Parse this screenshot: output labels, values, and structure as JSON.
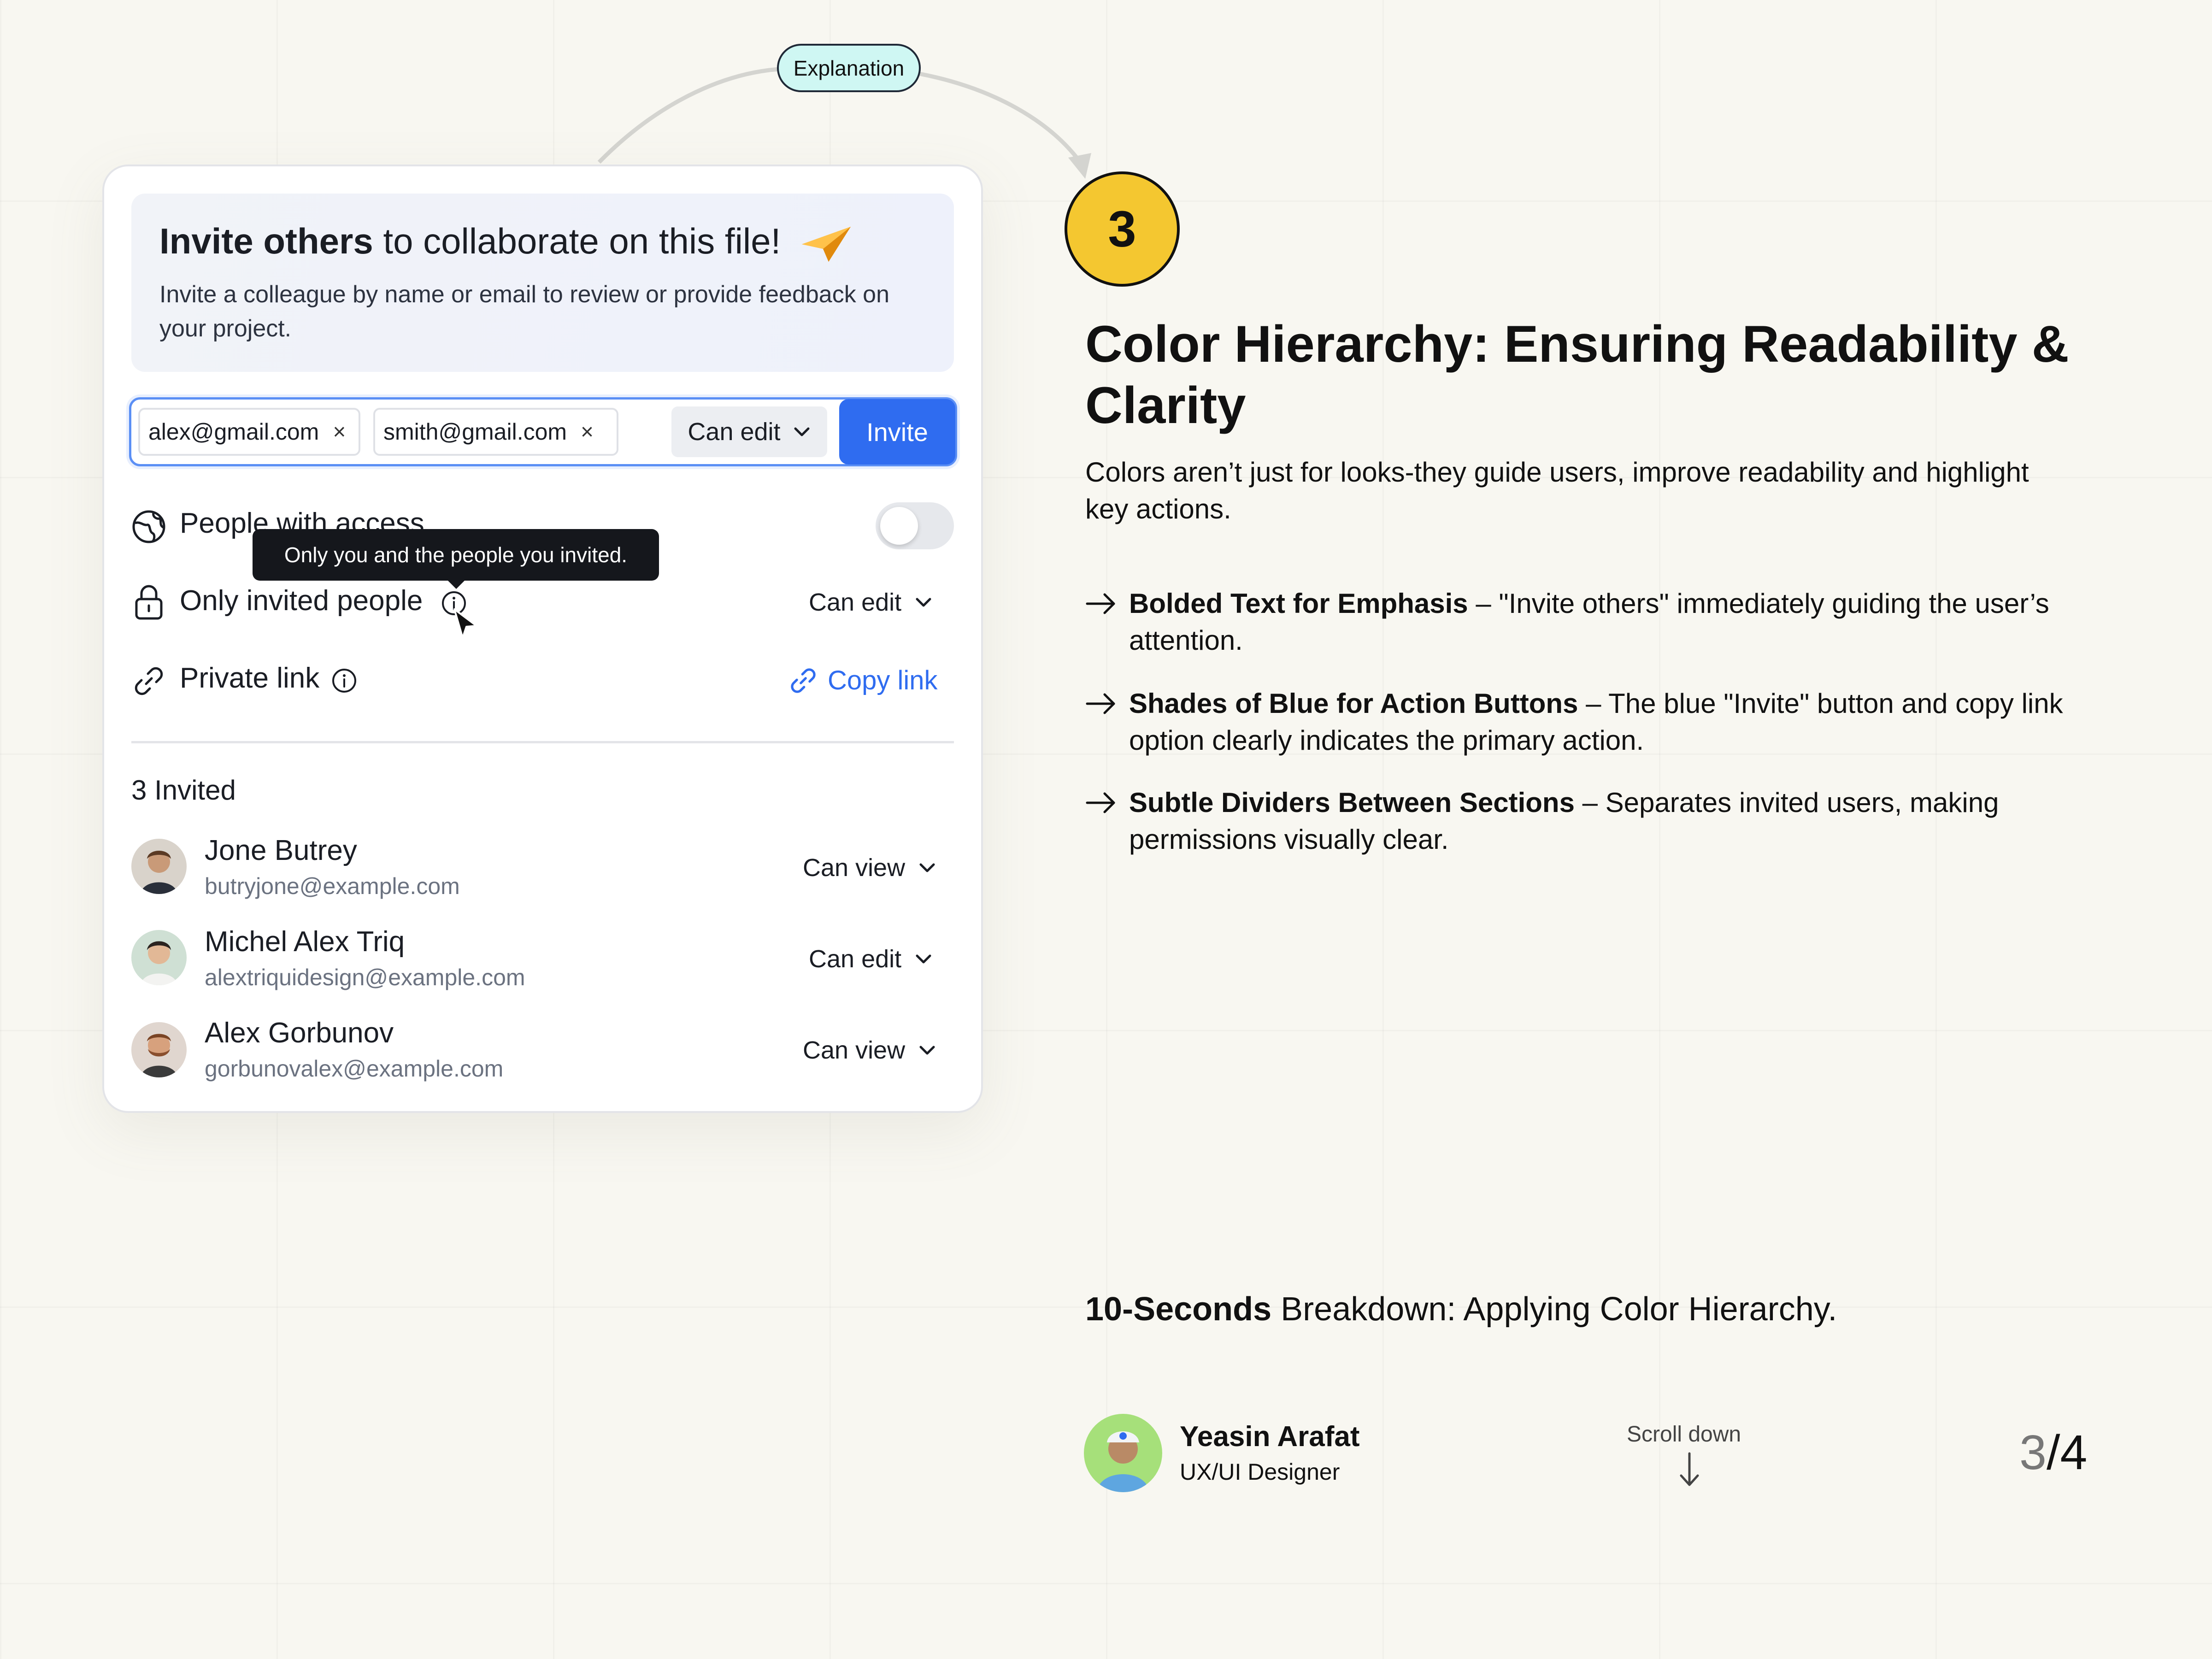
{
  "pill": {
    "label": "Explanation"
  },
  "card": {
    "title_bold": "Invite others",
    "title_rest": " to collaborate on this file!",
    "subtitle": "Invite a colleague by name or email to review or provide feedback on your project.",
    "chips": [
      "alex@gmail.com",
      "smith@gmail.com"
    ],
    "chip_remove": "×",
    "permission": "Can edit",
    "invite_button": "Invite",
    "people_with_access": "People with access",
    "tooltip": "Only you and the people you invited.",
    "only_invited": "Only invited people",
    "only_invited_perm": "Can edit",
    "private_link": "Private link",
    "copy_link": "Copy link",
    "invited_count": "3 Invited",
    "people": [
      {
        "name": "Jone Butrey",
        "email": "butryjone@example.com",
        "permission": "Can view"
      },
      {
        "name": "Michel Alex Triq",
        "email": "alextriquidesign@example.com",
        "permission": "Can edit"
      },
      {
        "name": "Alex Gorbunov",
        "email": "gorbunovalex@example.com",
        "permission": "Can view"
      }
    ]
  },
  "step": {
    "number": "3"
  },
  "heading": "Color Hierarchy: Ensuring Readability & Clarity",
  "lede": "Colors aren’t just for looks-they guide users, improve readability and highlight key actions.",
  "bullets": [
    {
      "bold": "Bolded Text for Emphasis",
      "rest": " – \"Invite others\" immediately guiding the user’s attention."
    },
    {
      "bold": "Shades of Blue for Action Buttons",
      "rest": " – The blue \"Invite\" button and copy link option clearly indicates the primary action."
    },
    {
      "bold": "Subtle Dividers Between Sections",
      "rest": " – Separates invited users, making permissions visually clear."
    }
  ],
  "breakdown": {
    "bold": "10-Seconds",
    "rest": " Breakdown: Applying Color Hierarchy."
  },
  "author": {
    "name": "Yeasin Arafat",
    "role": "UX/UI Designer"
  },
  "scroll": {
    "label": "Scroll down"
  },
  "pager": {
    "current": "3",
    "separator": "/",
    "total": "4"
  },
  "colors": {
    "accent": "#2f6cf0",
    "badge": "#f4c730",
    "pill_bg": "#cff7f3",
    "tooltip_bg": "#15171c"
  }
}
